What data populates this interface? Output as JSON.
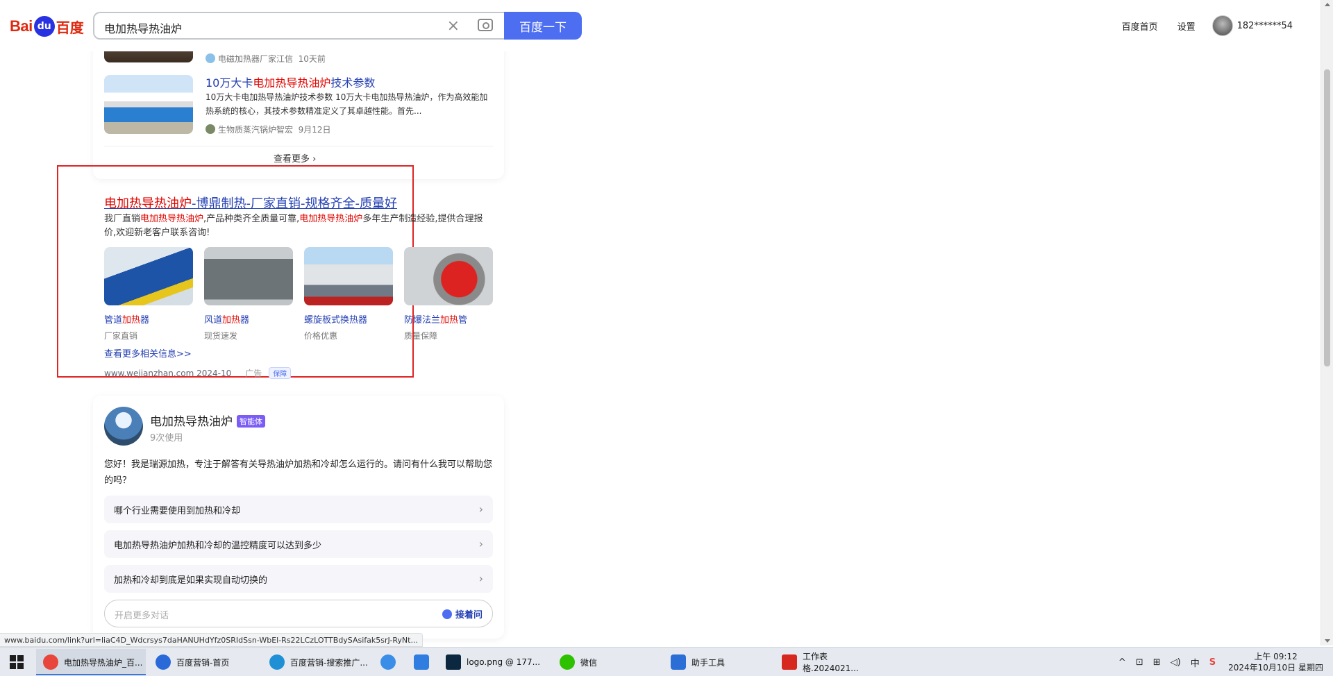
{
  "header": {
    "logo_bai": "Bai",
    "logo_du": "du",
    "logo_cn": "百度",
    "search_query": "电加热导热油炉",
    "search_button": "百度一下",
    "links": [
      "百度首页",
      "设置"
    ],
    "user": "182******54"
  },
  "news": {
    "top_source": "电磁加热器厂家江信",
    "top_time": "10天前",
    "item": {
      "title_pre": "10万大卡",
      "title_red": "电加热导热油炉",
      "title_post": "技术参数",
      "desc": "10万大卡电加热导热油炉技术参数 10万大卡电加热导热油炉，作为高效能加热系统的核心，其技术参数精准定义了其卓越性能。首先...",
      "source": "生物质蒸汽锅炉智宏",
      "time": "9月12日"
    },
    "more": "查看更多 ›"
  },
  "ad": {
    "title_red": "电加热导热油炉",
    "title_rest": "-博鼎制热-厂家直销-规格齐全-质量好",
    "desc_1": "我厂直销",
    "desc_red1": "电加热导热油炉",
    "desc_2": ",产品种类齐全质量可靠,",
    "desc_red2": "电加热导热油炉",
    "desc_3": "多年生产制造经验,提供合理报价,欢迎新老客户联系咨询!",
    "items": [
      {
        "name_pre": "管道",
        "name_red": "加热",
        "name_post": "器",
        "tag": "厂家直销"
      },
      {
        "name_pre": "风道",
        "name_red": "加热",
        "name_post": "器",
        "tag": "现货速发"
      },
      {
        "name_pre": "螺旋板式换热器",
        "name_red": "",
        "name_post": "",
        "tag": "价格优惠"
      },
      {
        "name_pre": "防爆法兰",
        "name_red": "加热",
        "name_post": "管",
        "tag": "质量保障"
      }
    ],
    "more": "查看更多相关信息>>",
    "url": "www.wejianzhan.com 2024-10",
    "ad_label": "广告",
    "guarantee": "保障"
  },
  "agent": {
    "name": "电加热导热油炉",
    "badge": "智能体",
    "uses": "9次使用",
    "greeting": "您好！我是瑞源加热，专注于解答有关导热油炉加热和冷却怎么运行的。请问有什么我可以帮助您的吗？",
    "questions": [
      "哪个行业需要使用到加热和冷却",
      "电加热导热油炉加热和冷却的温控精度可以达到多少",
      "加热和冷却到底是如果实现自动切换的"
    ],
    "input_placeholder": "开启更多对话",
    "ask_button": "接着问"
  },
  "status_url": "www.baidu.com/link?url=liaC4D_Wdcrsys7daHANUHdYfz0SRIdSsn-WbEl-Rs22LCzLOTTBdySAsifak5srJ-RyNt...",
  "taskbar": {
    "tasks": [
      {
        "label": "电加热导热油炉_百...",
        "icon_color": "#e8453c"
      },
      {
        "label": "百度营销-首页",
        "icon_color": "#2a6ad8"
      },
      {
        "label": "百度营销-搜索推广...",
        "icon_color": "#1f8fd6"
      },
      {
        "label": "",
        "icon_color": "#3b8ee8"
      },
      {
        "label": "",
        "icon_color": "#2f7de1"
      },
      {
        "label": "logo.png @ 177...",
        "icon_color": "#0b2840"
      },
      {
        "label": "微信",
        "icon_color": "#2dc100"
      },
      {
        "label": "助手工具",
        "icon_color": "#2b6fd6"
      },
      {
        "label": "工作表格.2024021...",
        "icon_color": "#d6281e"
      }
    ],
    "tray": [
      "^",
      "⊡",
      "⊞",
      "◁)",
      "中",
      "S"
    ],
    "time": "上午 09:12",
    "date": "2024年10月10日 星期四"
  }
}
